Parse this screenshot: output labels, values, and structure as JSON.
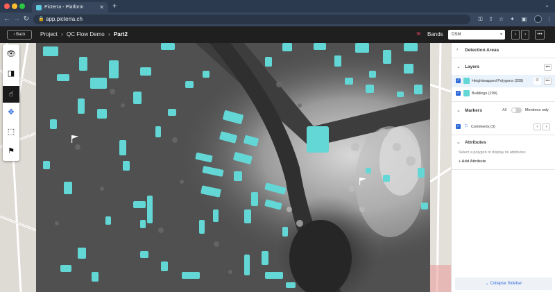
{
  "browser": {
    "tab_title": "Picterra - Platform",
    "new_tab_icon": "plus-icon",
    "url": "app.picterra.ch"
  },
  "header": {
    "back_label": "Back",
    "breadcrumb": [
      "Project",
      "QC Flow Demo",
      "Part2"
    ],
    "bands_label": "Bands",
    "band_value": "DSM",
    "more_label": "•••"
  },
  "tools": [
    {
      "name": "eye-icon",
      "glyph": "👁"
    },
    {
      "name": "compare-icon",
      "glyph": "◨"
    },
    {
      "name": "hand-icon",
      "glyph": "☝"
    },
    {
      "name": "move-icon",
      "glyph": "✥"
    },
    {
      "name": "select-area-icon",
      "glyph": "⬚"
    },
    {
      "name": "flag-icon",
      "glyph": "⚑"
    }
  ],
  "sidebar": {
    "detection_areas_title": "Detection Areas",
    "layers_title": "Layers",
    "layers_more": "•••",
    "layers": [
      {
        "label": "Heightmapped Polygons (209)",
        "color": "#63d7d5",
        "active": true
      },
      {
        "label": "Buildings (209)",
        "color": "#63d7d5",
        "active": false
      }
    ],
    "markers_title": "Markers",
    "markers_all": "All",
    "markers_mentions": "Mentions only",
    "comments_label": "Comments (3)",
    "attributes_title": "Attributes",
    "attributes_hint": "Select a polygon to display its attributes",
    "add_attribute": "+ Add Attribute",
    "collapse_label": "Collapse Sidebar"
  },
  "colors": {
    "polygon": "#63d7d5",
    "accent": "#2f6bd8",
    "bands_icon": "#e0425a"
  }
}
